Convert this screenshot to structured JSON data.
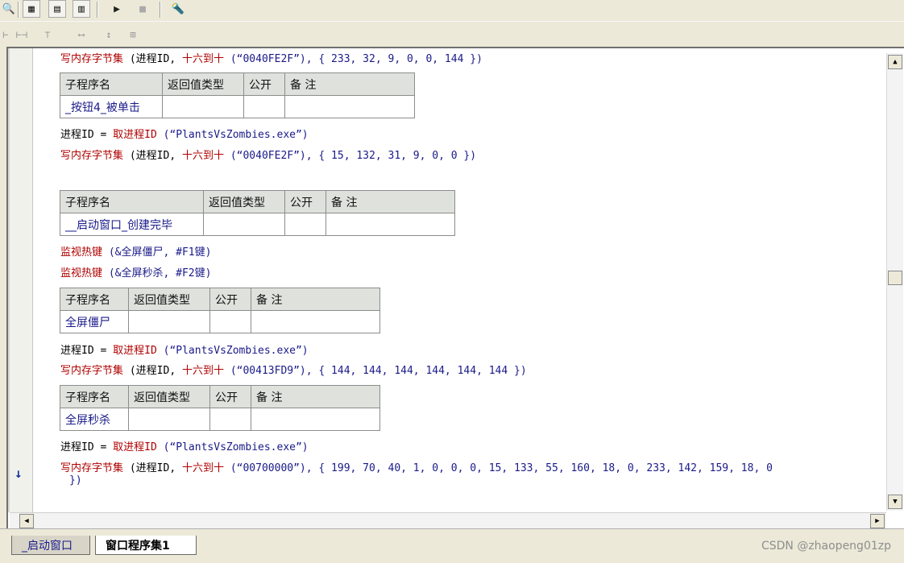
{
  "toolbar": {
    "icons": [
      "search-icon",
      "layout-1-icon",
      "layout-2-icon",
      "layout-3-icon",
      "run-icon",
      "stop-icon",
      "debug-icon"
    ]
  },
  "editor": {
    "line1": {
      "fn": "写内存字节集",
      "args": " (进程ID, ",
      "hex": "十六到十",
      "str": " (“0040FE2F”), { 233, 32, 9, 0, 0, 144 })"
    },
    "table_headers": {
      "name": "子程序名",
      "ret": "返回值类型",
      "pub": "公开",
      "note": "备 注"
    },
    "sub1": {
      "name": "_按钮4_被单击"
    },
    "line2": {
      "var": "进程ID = ",
      "fn": "取进程ID",
      "arg": " (“PlantsVsZombies.exe”)"
    },
    "line3": {
      "fn": "写内存字节集",
      "args": " (进程ID, ",
      "hex": "十六到十",
      "str": " (“0040FE2F”), { 15, 132, 31, 9, 0, 0 })"
    },
    "sub2": {
      "name": "__启动窗口_创建完毕"
    },
    "line4": {
      "fn": "监视热键",
      "args": " (&全屏僵尸, #F1键)"
    },
    "line5": {
      "fn": "监视热键",
      "args": " (&全屏秒杀, #F2键)"
    },
    "sub3": {
      "name": "全屏僵尸"
    },
    "line6": {
      "var": "进程ID = ",
      "fn": "取进程ID",
      "arg": " (“PlantsVsZombies.exe”)"
    },
    "line7": {
      "fn": "写内存字节集",
      "args": " (进程ID, ",
      "hex": "十六到十",
      "str": " (“00413FD9”), { 144, 144, 144, 144, 144, 144 })"
    },
    "sub4": {
      "name": "全屏秒杀"
    },
    "line8": {
      "var": "进程ID = ",
      "fn": "取进程ID",
      "arg": " (“PlantsVsZombies.exe”)"
    },
    "line9": {
      "fn": "写内存字节集",
      "args": " (进程ID, ",
      "hex": "十六到十",
      "str": " (“00700000”), { 199, 70, 40, 1, 0, 0, 0, 15, 133, 55, 160, 18, 0, 233, 142, 159, 18, 0"
    },
    "line10": {
      "text": "})"
    }
  },
  "tabs": [
    {
      "label": "_启动窗口"
    },
    {
      "label": "窗口程序集1"
    }
  ],
  "watermark": "CSDN @zhaopeng01zp"
}
